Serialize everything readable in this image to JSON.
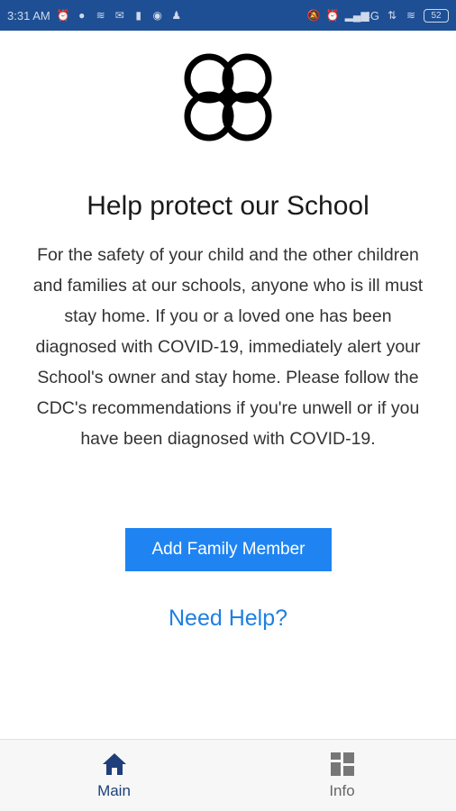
{
  "status_bar": {
    "time": "3:31 AM",
    "network": "4G",
    "battery": "52"
  },
  "main": {
    "title": "Help protect our School",
    "body": "For the safety of your child and the other children and families at our schools, anyone who is ill must stay home. If you or a loved one has been diagnosed with COVID-19, immediately alert your School's owner and stay home. Please follow the CDC's recommendations if you're unwell or if you have been diagnosed with COVID-19.",
    "add_button_label": "Add Family Member",
    "help_link_label": "Need Help?"
  },
  "bottom_nav": {
    "items": [
      {
        "label": "Main",
        "icon": "home-icon",
        "active": true
      },
      {
        "label": "Info",
        "icon": "grid-icon",
        "active": false
      }
    ]
  },
  "colors": {
    "status_bar": "#1e4f94",
    "button": "#1f84f2",
    "link": "#1f7fe0",
    "nav_active": "#1e3f7a"
  }
}
